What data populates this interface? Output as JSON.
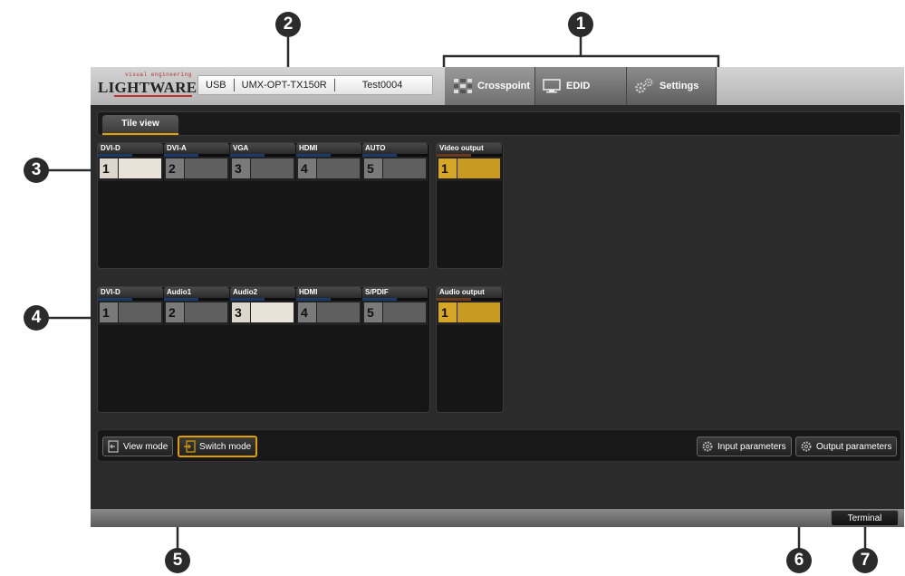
{
  "logo": {
    "tagline": "visual engineering",
    "name": "LIGHTWARE"
  },
  "device_info": {
    "connection": "USB",
    "model": "UMX-OPT-TX150R",
    "name": "Test0004"
  },
  "tabs": [
    {
      "label": "Crosspoint",
      "icon": "crosspoint-icon"
    },
    {
      "label": "EDID",
      "icon": "monitor-icon"
    },
    {
      "label": "Settings",
      "icon": "gears-icon"
    }
  ],
  "view_tab": "Tile view",
  "video": {
    "inputs": [
      {
        "name": "DVI-D",
        "number": "1",
        "selected": true
      },
      {
        "name": "DVI-A",
        "number": "2",
        "selected": false
      },
      {
        "name": "VGA",
        "number": "3",
        "selected": false
      },
      {
        "name": "HDMI",
        "number": "4",
        "selected": false
      },
      {
        "name": "AUTO",
        "number": "5",
        "selected": false
      }
    ],
    "output": {
      "name": "Video output",
      "number": "1"
    }
  },
  "audio": {
    "inputs": [
      {
        "name": "DVI-D",
        "number": "1",
        "selected": false
      },
      {
        "name": "Audio1",
        "number": "2",
        "selected": false
      },
      {
        "name": "Audio2",
        "number": "3",
        "selected": true
      },
      {
        "name": "HDMI",
        "number": "4",
        "selected": false
      },
      {
        "name": "S/PDIF",
        "number": "5",
        "selected": false
      }
    ],
    "output": {
      "name": "Audio output",
      "number": "1"
    }
  },
  "footer": {
    "view_mode": "View mode",
    "switch_mode": "Switch mode",
    "input_parameters": "Input parameters",
    "output_parameters": "Output parameters"
  },
  "terminal": "Terminal",
  "callouts": [
    "1",
    "2",
    "3",
    "4",
    "5",
    "6",
    "7"
  ],
  "colors": {
    "accent": "#e0a000",
    "output_active": "#d6a626",
    "selected_input": "#e8e2d8"
  }
}
